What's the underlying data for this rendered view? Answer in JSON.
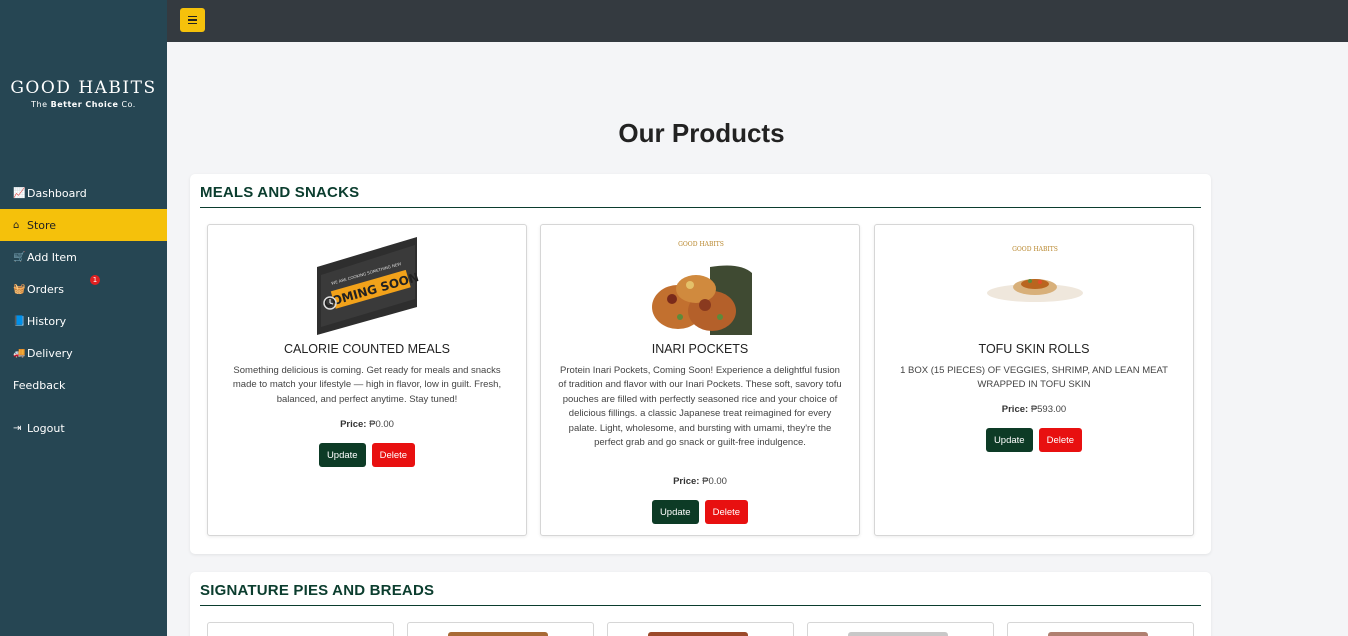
{
  "brand": {
    "name": "GOOD HABITS",
    "tagline_prefix": "The",
    "tagline_bold": "Better Choice",
    "tagline_suffix": "Co."
  },
  "sidebar": {
    "items": [
      {
        "label": "Dashboard",
        "icon": "chart-icon",
        "glyph": "📈"
      },
      {
        "label": "Store",
        "icon": "home-icon",
        "glyph": "⌂"
      },
      {
        "label": "Add Item",
        "icon": "cart-icon",
        "glyph": "🛒"
      },
      {
        "label": "Orders",
        "icon": "basket-icon",
        "glyph": "🧺",
        "badge": "1"
      },
      {
        "label": "History",
        "icon": "book-icon",
        "glyph": "📘"
      },
      {
        "label": "Delivery",
        "icon": "truck-icon",
        "glyph": "🚚"
      },
      {
        "label": "Feedback",
        "icon": "",
        "glyph": ""
      },
      {
        "label": "Logout",
        "icon": "logout-icon",
        "glyph": "⇥"
      }
    ]
  },
  "page": {
    "title": "Our Products"
  },
  "sections": [
    {
      "title": "MEALS AND SNACKS",
      "products": [
        {
          "name": "CALORIE COUNTED MEALS",
          "image_text": "COMING SOON",
          "image_subtext": "WE ARE COOKING SOMETHING NEW",
          "description": "Something delicious is coming. Get ready for meals and snacks made to match your lifestyle — high in flavor, low in guilt. Fresh, balanced, and perfect anytime. Stay tuned!",
          "price_label": "Price:",
          "price": "₱0.00",
          "update_label": "Update",
          "delete_label": "Delete"
        },
        {
          "name": "INARI POCKETS",
          "image_text": "GOOD HABITS",
          "description": "Protein Inari Pockets, Coming Soon! Experience a delightful fusion of tradition and flavor with our Inari Pockets. These soft, savory tofu pouches are filled with perfectly seasoned rice and your choice of delicious fillings. a classic Japanese treat reimagined for every palate. Light, wholesome, and bursting with umami, they're the perfect grab and go snack or guilt-free indulgence.",
          "price_label": "Price:",
          "price": "₱0.00",
          "update_label": "Update",
          "delete_label": "Delete"
        },
        {
          "name": "TOFU SKIN ROLLS",
          "image_text": "GOOD HABITS",
          "description": "1 BOX (15 PIECES) OF VEGGIES, SHRIMP, AND LEAN MEAT WRAPPED IN TOFU SKIN",
          "price_label": "Price:",
          "price": "₱593.00",
          "update_label": "Update",
          "delete_label": "Delete"
        }
      ]
    },
    {
      "title": "SIGNATURE PIES AND BREADS"
    }
  ],
  "colors": {
    "sidebar": "#264653",
    "accent": "#f5c10b",
    "topbar": "#343a40",
    "section_title": "#0b3d2e",
    "update_button": "#0d3b26",
    "delete_button": "#e81010"
  }
}
